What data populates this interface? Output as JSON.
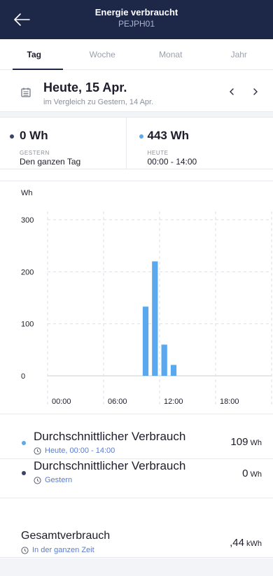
{
  "header": {
    "title": "Energie verbraucht",
    "subtitle": "PEJPH01",
    "back_icon": "back-arrow-icon"
  },
  "tabs": [
    {
      "label": "Tag",
      "active": true
    },
    {
      "label": "Woche",
      "active": false
    },
    {
      "label": "Monat",
      "active": false
    },
    {
      "label": "Jahr",
      "active": false
    }
  ],
  "date": {
    "title": "Heute, 15 Apr.",
    "subtitle": "im Vergleich zu Gestern, 14 Apr.",
    "prev": "‹",
    "next": "›"
  },
  "compare": {
    "yesterday": {
      "value": "0 Wh",
      "label": "GESTERN",
      "time": "Den ganzen Tag",
      "color": "#3a4466"
    },
    "today": {
      "value": "443 Wh",
      "label": "HEUTE",
      "time": "00:00 - 14:00",
      "color": "#5aa8ee"
    }
  },
  "chart_data": {
    "type": "bar",
    "ylabel": "Wh",
    "ylim": [
      0,
      300
    ],
    "yticks": [
      0,
      100,
      200,
      300
    ],
    "xticks": [
      "00:00",
      "06:00",
      "12:00",
      "18:00"
    ],
    "x": [
      10,
      11,
      12,
      13
    ],
    "values": [
      133,
      220,
      60,
      21
    ],
    "bar_color": "#5aa8ee"
  },
  "stats": [
    {
      "title": "Durchschnittlicher Verbrauch",
      "sub": "Heute, 00:00 - 14:00",
      "value": "109",
      "unit": "Wh",
      "dot_color": "#5aa8ee"
    },
    {
      "title": "Durchschnittlicher Verbrauch",
      "sub": "Gestern",
      "value": "0",
      "unit": "Wh",
      "dot_color": "#3a4466"
    },
    {
      "title": "Gesamtverbrauch",
      "sub": "In der ganzen Zeit",
      "value": ",44",
      "unit": "kWh"
    }
  ]
}
